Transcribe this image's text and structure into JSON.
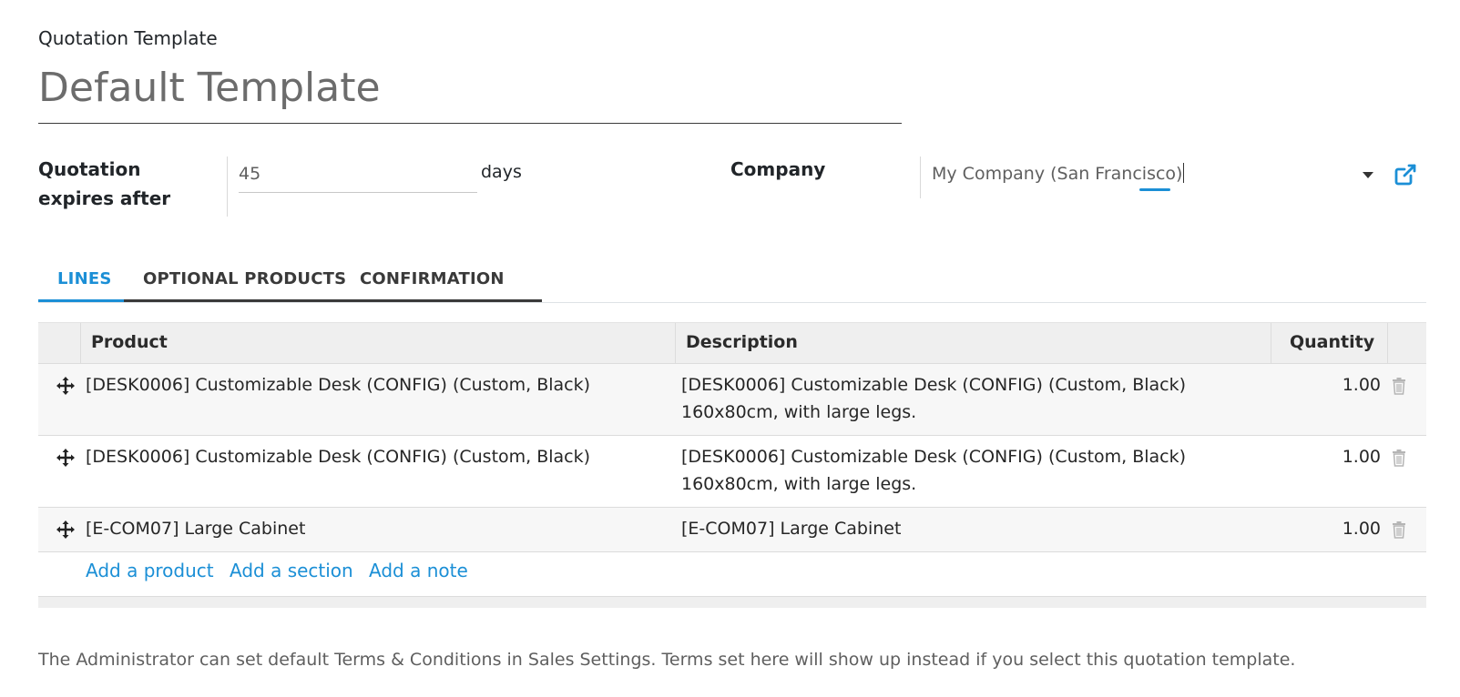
{
  "form": {
    "title_label": "Quotation Template",
    "name_value": "Default Template"
  },
  "expires": {
    "label": "Quotation expires after",
    "value": "45",
    "unit": "days"
  },
  "company": {
    "label": "Company",
    "value": "My Company (San Francisco)",
    "icons": [
      "caret-down-icon",
      "external-link-icon"
    ]
  },
  "tabs": [
    {
      "label": "LINES",
      "active": true
    },
    {
      "label": "OPTIONAL PRODUCTS",
      "active": false
    },
    {
      "label": "CONFIRMATION",
      "active": false
    }
  ],
  "table": {
    "columns": [
      "Product",
      "Description",
      "Quantity"
    ],
    "rows": [
      {
        "product": "[DESK0006] Customizable Desk (CONFIG) (Custom, Black)",
        "description_line1": "[DESK0006] Customizable Desk (CONFIG) (Custom, Black)",
        "description_line2": "160x80cm, with large legs.",
        "quantity": "1.00"
      },
      {
        "product": "[DESK0006] Customizable Desk (CONFIG) (Custom, Black)",
        "description_line1": "[DESK0006] Customizable Desk (CONFIG) (Custom, Black)",
        "description_line2": "160x80cm, with large legs.",
        "quantity": "1.00"
      },
      {
        "product": "[E-COM07] Large Cabinet",
        "description_line1": "[E-COM07] Large Cabinet",
        "description_line2": "",
        "quantity": "1.00"
      }
    ],
    "add_links": [
      "Add a product",
      "Add a section",
      "Add a note"
    ]
  },
  "terms_note": "The Administrator can set default Terms & Conditions in Sales Settings. Terms set here will show up instead if you select this quotation template.",
  "colors": {
    "accent": "#1b8fd6",
    "header_bg": "#efefef",
    "odd_row_bg": "#f7f7f7"
  }
}
